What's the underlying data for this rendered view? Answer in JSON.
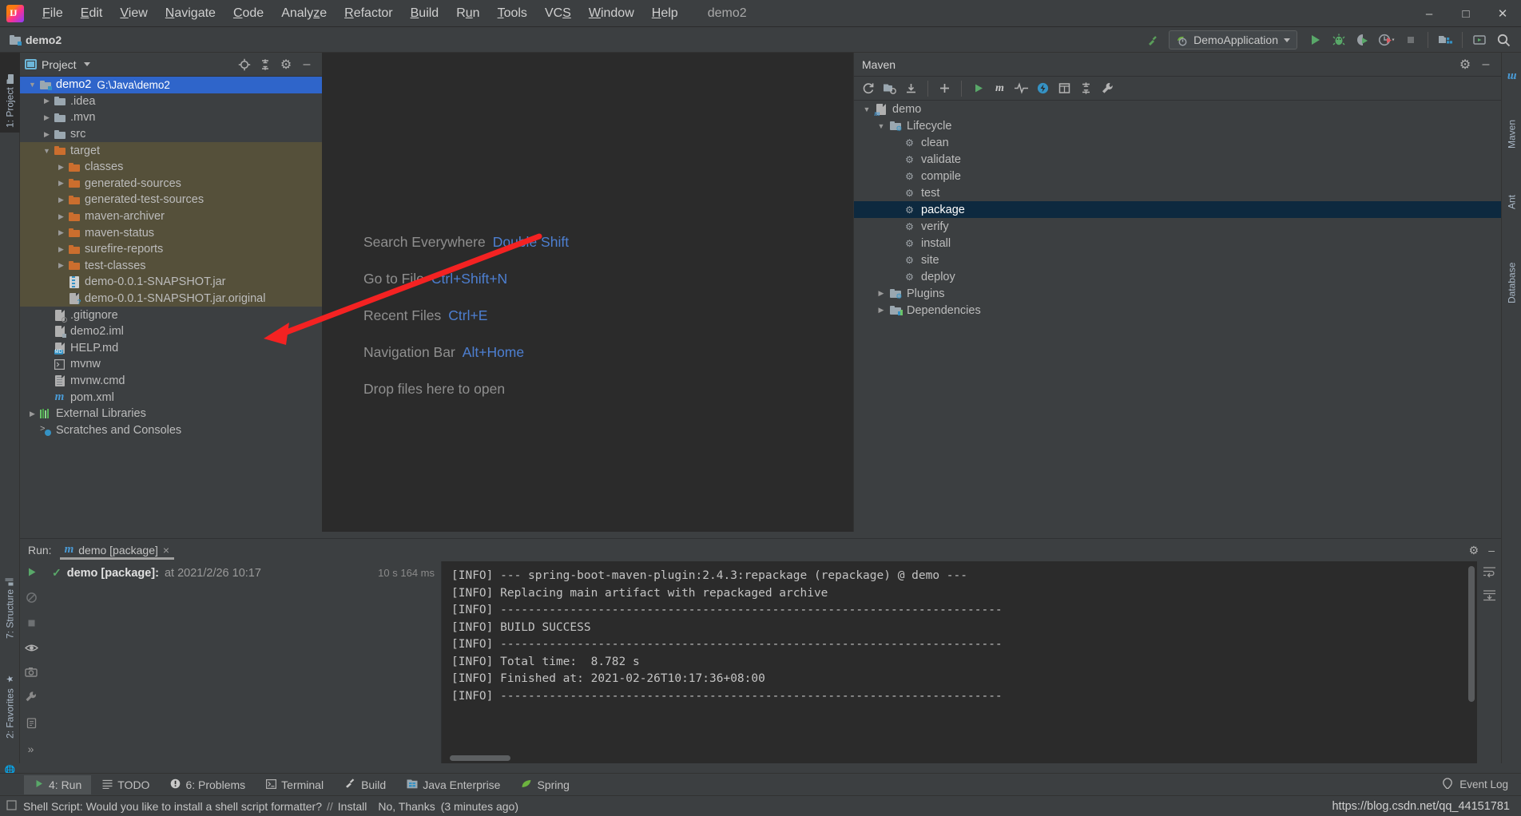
{
  "window": {
    "title": "demo2",
    "controls": [
      "minimize",
      "maximize",
      "close"
    ]
  },
  "menu": {
    "items": [
      {
        "label": "File",
        "mnemonic": "F"
      },
      {
        "label": "Edit",
        "mnemonic": "E"
      },
      {
        "label": "View",
        "mnemonic": "V"
      },
      {
        "label": "Navigate",
        "mnemonic": "N"
      },
      {
        "label": "Code",
        "mnemonic": "C"
      },
      {
        "label": "Analyze",
        "mnemonic": "z"
      },
      {
        "label": "Refactor",
        "mnemonic": "R"
      },
      {
        "label": "Build",
        "mnemonic": "B"
      },
      {
        "label": "Run",
        "mnemonic": "u"
      },
      {
        "label": "Tools",
        "mnemonic": "T"
      },
      {
        "label": "VCS",
        "mnemonic": "S"
      },
      {
        "label": "Window",
        "mnemonic": "W"
      },
      {
        "label": "Help",
        "mnemonic": "H"
      }
    ]
  },
  "navbar": {
    "breadcrumb": "demo2",
    "run_configuration": "DemoApplication",
    "icons": [
      "build-hammer-icon",
      "run-icon",
      "debug-icon",
      "run-coverage-icon",
      "profiler-icon",
      "stop-icon",
      "project-structure-icon",
      "search-everywhere-icon"
    ]
  },
  "left_strip": {
    "tabs": [
      {
        "label": "1: Project",
        "active": true,
        "icon": "project-folder-icon"
      },
      {
        "label": "7: Structure",
        "active": false,
        "icon": "structure-icon"
      },
      {
        "label": "2: Favorites",
        "active": false,
        "icon": "star-icon"
      },
      {
        "label": "Web",
        "active": false,
        "icon": "web-globe-icon"
      }
    ]
  },
  "right_strip": {
    "tabs": [
      {
        "label": "m",
        "icon": "maven-icon"
      },
      {
        "label": "Maven",
        "icon": "maven-icon"
      },
      {
        "label": "Ant",
        "icon": "ant-icon"
      },
      {
        "label": "Database",
        "icon": "database-icon"
      }
    ]
  },
  "project_panel": {
    "title": "Project",
    "header_icons": [
      "locate-icon",
      "collapse-all-icon",
      "gear-icon",
      "minimize-icon"
    ],
    "tree": [
      {
        "depth": 0,
        "arrow": "down",
        "icon": "module-folder-icon",
        "label": "demo2",
        "sub": "G:\\Java\\demo2",
        "state": "selected"
      },
      {
        "depth": 1,
        "arrow": "right",
        "icon": "folder-gray-icon",
        "label": ".idea",
        "sub": "",
        "state": "normal"
      },
      {
        "depth": 1,
        "arrow": "right",
        "icon": "folder-gray-icon",
        "label": ".mvn",
        "sub": "",
        "state": "normal"
      },
      {
        "depth": 1,
        "arrow": "right",
        "icon": "folder-gray-icon",
        "label": "src",
        "sub": "",
        "state": "normal"
      },
      {
        "depth": 1,
        "arrow": "down",
        "icon": "folder-orange-icon",
        "label": "target",
        "sub": "",
        "state": "highlight"
      },
      {
        "depth": 2,
        "arrow": "right",
        "icon": "folder-orange-icon",
        "label": "classes",
        "sub": "",
        "state": "highlight"
      },
      {
        "depth": 2,
        "arrow": "right",
        "icon": "folder-orange-icon",
        "label": "generated-sources",
        "sub": "",
        "state": "highlight"
      },
      {
        "depth": 2,
        "arrow": "right",
        "icon": "folder-orange-icon",
        "label": "generated-test-sources",
        "sub": "",
        "state": "highlight"
      },
      {
        "depth": 2,
        "arrow": "right",
        "icon": "folder-orange-icon",
        "label": "maven-archiver",
        "sub": "",
        "state": "highlight"
      },
      {
        "depth": 2,
        "arrow": "right",
        "icon": "folder-orange-icon",
        "label": "maven-status",
        "sub": "",
        "state": "highlight"
      },
      {
        "depth": 2,
        "arrow": "right",
        "icon": "folder-orange-icon",
        "label": "surefire-reports",
        "sub": "",
        "state": "highlight"
      },
      {
        "depth": 2,
        "arrow": "right",
        "icon": "folder-orange-icon",
        "label": "test-classes",
        "sub": "",
        "state": "highlight"
      },
      {
        "depth": 2,
        "arrow": "none",
        "icon": "jar-file-icon",
        "label": "demo-0.0.1-SNAPSHOT.jar",
        "sub": "",
        "state": "highlight"
      },
      {
        "depth": 2,
        "arrow": "none",
        "icon": "unknown-file-icon",
        "label": "demo-0.0.1-SNAPSHOT.jar.original",
        "sub": "",
        "state": "highlight"
      },
      {
        "depth": 1,
        "arrow": "none",
        "icon": "gitignore-file-icon",
        "label": ".gitignore",
        "sub": "",
        "state": "normal"
      },
      {
        "depth": 1,
        "arrow": "none",
        "icon": "iml-file-icon",
        "label": "demo2.iml",
        "sub": "",
        "state": "normal"
      },
      {
        "depth": 1,
        "arrow": "none",
        "icon": "markdown-file-icon",
        "label": "HELP.md",
        "sub": "",
        "state": "normal"
      },
      {
        "depth": 1,
        "arrow": "none",
        "icon": "shell-script-icon",
        "label": "mvnw",
        "sub": "",
        "state": "normal"
      },
      {
        "depth": 1,
        "arrow": "none",
        "icon": "cmd-file-icon",
        "label": "mvnw.cmd",
        "sub": "",
        "state": "normal"
      },
      {
        "depth": 1,
        "arrow": "none",
        "icon": "maven-pom-icon",
        "label": "pom.xml",
        "sub": "",
        "state": "normal"
      },
      {
        "depth": 0,
        "arrow": "right",
        "icon": "libraries-icon",
        "label": "External Libraries",
        "sub": "",
        "state": "normal"
      },
      {
        "depth": 0,
        "arrow": "none",
        "icon": "scratches-icon",
        "label": "Scratches and Consoles",
        "sub": "",
        "state": "normal"
      }
    ]
  },
  "editor": {
    "shortcuts": [
      {
        "action": "Search Everywhere",
        "keys": "Double Shift"
      },
      {
        "action": "Go to File",
        "keys": "Ctrl+Shift+N"
      },
      {
        "action": "Recent Files",
        "keys": "Ctrl+E"
      },
      {
        "action": "Navigation Bar",
        "keys": "Alt+Home"
      },
      {
        "action": "Drop files here to open",
        "keys": ""
      }
    ],
    "annotation": {
      "type": "red-arrow",
      "color": "#f42222",
      "points_to": "demo-0.0.1-SNAPSHOT.jar"
    }
  },
  "maven_panel": {
    "title": "Maven",
    "header_icons": [
      "gear-icon",
      "minimize-icon"
    ],
    "toolbar_icons": [
      "reload-icon",
      "add-maven-projects-icon",
      "download-sources-icon",
      "plus-icon",
      "run-icon",
      "maven-m-icon",
      "toggle-skip-tests-icon",
      "execute-goal-icon",
      "show-dependencies-icon",
      "collapse-all-icon",
      "settings-wrench-icon"
    ],
    "tree": [
      {
        "depth": 0,
        "arrow": "down",
        "icon": "maven-project-icon",
        "label": "demo",
        "state": "normal"
      },
      {
        "depth": 1,
        "arrow": "down",
        "icon": "lifecycle-folder-icon",
        "label": "Lifecycle",
        "state": "normal"
      },
      {
        "depth": 2,
        "arrow": "none",
        "icon": "goal-gear-icon",
        "label": "clean",
        "state": "normal"
      },
      {
        "depth": 2,
        "arrow": "none",
        "icon": "goal-gear-icon",
        "label": "validate",
        "state": "normal"
      },
      {
        "depth": 2,
        "arrow": "none",
        "icon": "goal-gear-icon",
        "label": "compile",
        "state": "normal"
      },
      {
        "depth": 2,
        "arrow": "none",
        "icon": "goal-gear-icon",
        "label": "test",
        "state": "normal"
      },
      {
        "depth": 2,
        "arrow": "none",
        "icon": "goal-gear-icon",
        "label": "package",
        "state": "selected"
      },
      {
        "depth": 2,
        "arrow": "none",
        "icon": "goal-gear-icon",
        "label": "verify",
        "state": "normal"
      },
      {
        "depth": 2,
        "arrow": "none",
        "icon": "goal-gear-icon",
        "label": "install",
        "state": "normal"
      },
      {
        "depth": 2,
        "arrow": "none",
        "icon": "goal-gear-icon",
        "label": "site",
        "state": "normal"
      },
      {
        "depth": 2,
        "arrow": "none",
        "icon": "goal-gear-icon",
        "label": "deploy",
        "state": "normal"
      },
      {
        "depth": 1,
        "arrow": "right",
        "icon": "plugins-folder-icon",
        "label": "Plugins",
        "state": "normal"
      },
      {
        "depth": 1,
        "arrow": "right",
        "icon": "dependencies-folder-icon",
        "label": "Dependencies",
        "state": "normal"
      }
    ]
  },
  "run_panel": {
    "label": "Run:",
    "tab_label": "demo [package]",
    "tab_close": "×",
    "header_icons": [
      "gear-icon",
      "minimize-icon"
    ],
    "gutter_icons": [
      "rerun-icon",
      "rerun-failed-icon",
      "stop-icon",
      "eye-toggle-icon",
      "camera-icon",
      "settings-icon",
      "export-icon",
      "more-icon"
    ],
    "side_icons": [
      "soft-wrap-icon",
      "scroll-to-end-icon"
    ],
    "tree_node": {
      "status": "✓",
      "name": "demo [package]:",
      "at": "at 2021/2/26 10:17",
      "duration": "10 s 164 ms"
    },
    "console_lines": [
      "[INFO] --- spring-boot-maven-plugin:2.4.3:repackage (repackage) @ demo ---",
      "[INFO] Replacing main artifact with repackaged archive",
      "[INFO] ------------------------------------------------------------------------",
      "[INFO] BUILD SUCCESS",
      "[INFO] ------------------------------------------------------------------------",
      "[INFO] Total time:  8.782 s",
      "[INFO] Finished at: 2021-02-26T10:17:36+08:00",
      "[INFO] ------------------------------------------------------------------------"
    ]
  },
  "bottom_tabs": [
    {
      "label": "4: Run",
      "mnemonic": "4",
      "icon": "run-icon",
      "active": true
    },
    {
      "label": "TODO",
      "mnemonic": "",
      "icon": "todo-list-icon",
      "active": false
    },
    {
      "label": "6: Problems",
      "mnemonic": "6",
      "icon": "problems-icon",
      "active": false
    },
    {
      "label": "Terminal",
      "mnemonic": "",
      "icon": "terminal-icon",
      "active": false
    },
    {
      "label": "Build",
      "mnemonic": "",
      "icon": "build-hammer-icon",
      "active": false
    },
    {
      "label": "Java Enterprise",
      "mnemonic": "",
      "icon": "java-enterprise-icon",
      "active": false
    },
    {
      "label": "Spring",
      "mnemonic": "",
      "icon": "spring-leaf-icon",
      "active": false
    }
  ],
  "event_log": {
    "label": "Event Log",
    "icon": "balloon-icon"
  },
  "statusbar": {
    "message": "Shell Script: Would you like to install a shell script formatter?",
    "separator": "//",
    "action_install": "Install",
    "action_dismiss": "No, Thanks",
    "time": "(3 minutes ago)",
    "watermark": "https://blog.csdn.net/qq_44151781"
  },
  "colors": {
    "accent_blue": "#4d7fd1",
    "selection_blue": "#2f65ca",
    "maven_selection": "#0d293f",
    "target_highlight": "#55503a",
    "folder_orange": "#cb6e2e",
    "folder_gray": "#9aa7b0",
    "arrow_red": "#f42222",
    "panel_bg": "#3c3f41",
    "editor_bg": "#2b2b2b",
    "success_green": "#4f9e4f"
  }
}
